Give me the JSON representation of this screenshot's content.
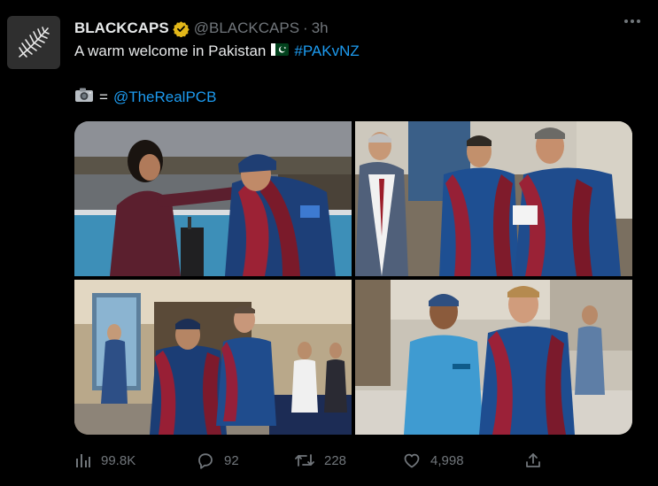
{
  "tweet": {
    "display_name": "BLACKCAPS",
    "handle": "@BLACKCAPS",
    "separator": "·",
    "time": "3h",
    "text_intro": "A warm welcome in Pakistan",
    "hashtag": "#PAKvNZ",
    "credit_equals": "=",
    "credit_mention": "@TheRealPCB"
  },
  "media": {
    "photos": [
      {
        "icon": "photo-welcome-scarf"
      },
      {
        "icon": "photo-players-scarves"
      },
      {
        "icon": "photo-team-arrival"
      },
      {
        "icon": "photo-staff-greeting"
      }
    ]
  },
  "actions": {
    "views": "99.8K",
    "replies": "92",
    "retweets": "228",
    "likes": "4,998"
  },
  "colors": {
    "background": "#000000",
    "text": "#e7e9ea",
    "muted": "#71767b",
    "link": "#1d9bf0",
    "verified_gold": "#e2b719"
  }
}
